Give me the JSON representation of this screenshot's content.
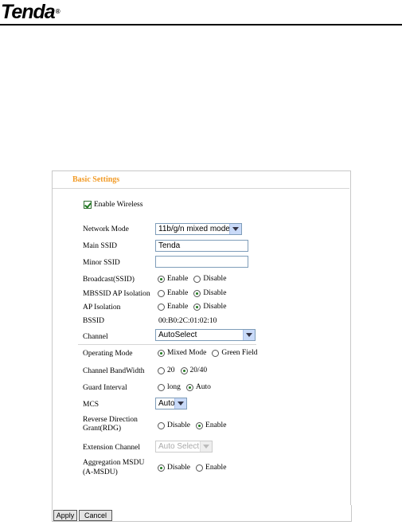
{
  "brand": {
    "logo": "Tenda",
    "reg_mark": "®"
  },
  "panel": {
    "title": "Basic Settings"
  },
  "enable_wireless": {
    "label": "Enable Wireless",
    "checked": true
  },
  "network_mode": {
    "label": "Network Mode",
    "value": "11b/g/n mixed mode"
  },
  "main_ssid": {
    "label": "Main SSID",
    "value": "Tenda"
  },
  "minor_ssid": {
    "label": "Minor SSID",
    "value": ""
  },
  "broadcast": {
    "label": "Broadcast(SSID)",
    "options": [
      "Enable",
      "Disable"
    ],
    "selected": "Enable"
  },
  "mbssid": {
    "label": "MBSSID AP Isolation",
    "options": [
      "Enable",
      "Disable"
    ],
    "selected": "Disable"
  },
  "ap_isolation": {
    "label": "AP Isolation",
    "options": [
      "Enable",
      "Disable"
    ],
    "selected": "Disable"
  },
  "bssid": {
    "label": "BSSID",
    "value": "00:B0:2C:01:02:10"
  },
  "channel": {
    "label": "Channel",
    "value": "AutoSelect"
  },
  "operating_mode": {
    "label": "Operating Mode",
    "options": [
      "Mixed Mode",
      "Green Field"
    ],
    "selected": "Mixed Mode"
  },
  "bandwidth": {
    "label": "Channel BandWidth",
    "options": [
      "20",
      "20/40"
    ],
    "selected": "20/40"
  },
  "guard_interval": {
    "label": "Guard Interval",
    "options": [
      "long",
      "Auto"
    ],
    "selected": "Auto"
  },
  "mcs": {
    "label": "MCS",
    "value": "Auto"
  },
  "rdg": {
    "label_line1": "Reverse Direction",
    "label_line2": "Grant(RDG)",
    "options": [
      "Disable",
      "Enable"
    ],
    "selected": "Enable"
  },
  "extension_channel": {
    "label": "Extension Channel",
    "value": "Auto Select"
  },
  "amsdu": {
    "label_line1": "Aggregation MSDU",
    "label_line2": "(A-MSDU)",
    "options": [
      "Disable",
      "Enable"
    ],
    "selected": "Disable"
  },
  "buttons": {
    "apply": "Apply",
    "cancel": "Cancel"
  },
  "colors": {
    "title": "#f29b27",
    "radio_dot": "#1f7a1f",
    "select_border": "#7f9db9"
  }
}
